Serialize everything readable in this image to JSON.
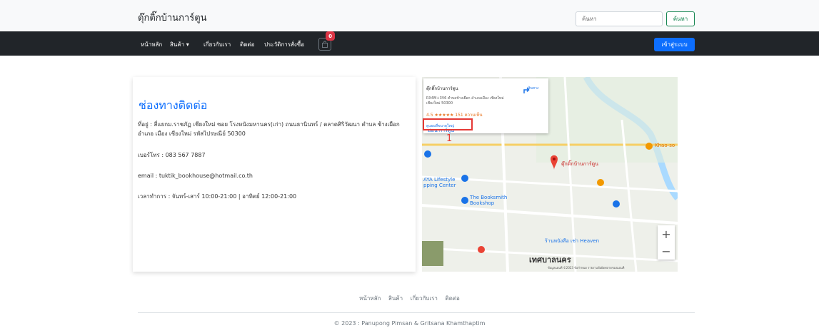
{
  "header": {
    "brand": "ตุ๊กติ๊กบ้านการ์ตูน",
    "search_placeholder": "ค้นหา",
    "search_label": "ค้นหา"
  },
  "nav": {
    "items": [
      "หน้าหลัก",
      "สินค้า ▾",
      "เกี่ยวกับเรา",
      "ติดต่อ",
      "ประวัติการสั่งซื้อ"
    ],
    "cart_count": "0",
    "login_label": "เข้าสู่ระบบ"
  },
  "contact": {
    "title": "ช่องทางติดต่อ",
    "address": "ที่อยู่ : สี่แยกม.ราชภัฏ เชียงใหม่ ซอย โรงหนังมหานคร(เก่า) ถนนธานินทร์ / ตลาดศิริวัฒนา ตำบล ช้างเผือก อำเภอ เมือง เชียงใหม่ รหัสไปรษณีย์ 50300",
    "phone": "เบอร์โทร : 083 567 7887",
    "email": "email : tuktik_bookhouse@hotmail.co.th",
    "hours": "เวลาทำการ : จันทร์-เสาร์ 10:00-21:00 | อาทิตย์ 12:00-21:00"
  },
  "map": {
    "popup_title": "ตุ๊กติ๊กบ้านการ์ตูน",
    "popup_address": "RX4M+3V6 ตำบลช้างเผือก อำเภอเมือง เชียงใหม่ เชียงใหม่ 50300",
    "popup_rating": "4.5 ★★★★★  151 ความเห็น",
    "popup_link": "ดูแผนที่ขนาดใหญ่",
    "popup_directions": "เส้นทาง",
    "annotation_number": "1",
    "labels": {
      "pin": "ตุ๊กติ๊กบ้านการ์ตูน",
      "bookshop": "The Booksmith Bookshop",
      "maya": "AYA Lifestyle pping Center",
      "mon": "ม่อน การ์ตูน",
      "city": "เทศบาลนคร",
      "heaven": "ร้านหนังสือ เช่า Heaven",
      "khaosoi": "Khao-so",
      "zoom_in": "+",
      "zoom_out": "−",
      "attribution": "ข้อมูลแผนที่ ©2023  ข้อกำหนด  รายงานข้อผิดพลาดของแผนที่"
    }
  },
  "footer": {
    "links": [
      "หน้าหลัก",
      "สินค้า",
      "เกี่ยวกับเรา",
      "ติดต่อ"
    ],
    "copyright": "© 2023 : Panupong Pimsan & Gritsana Khamthaptim"
  }
}
